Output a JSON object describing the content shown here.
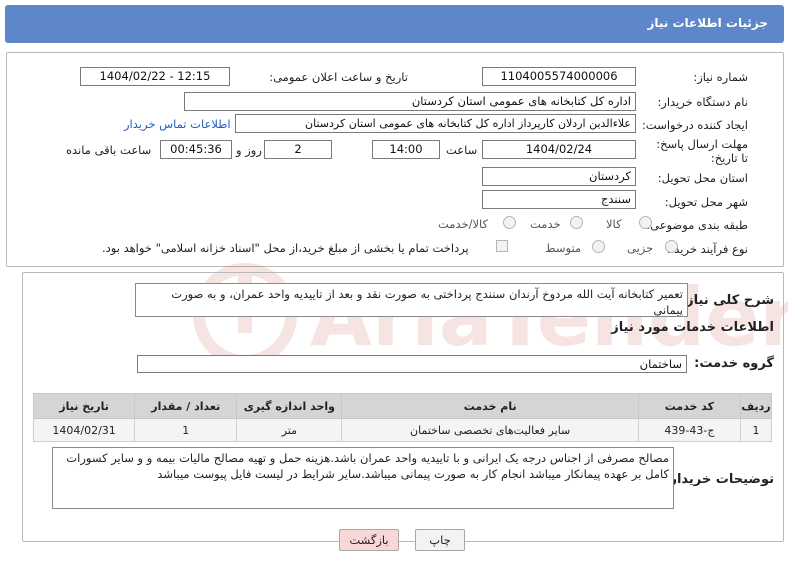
{
  "header": {
    "title": "جزئیات اطلاعات نیاز"
  },
  "form": {
    "need_number_label": "شماره نیاز:",
    "need_number": "1104005574000006",
    "announce_label": "تاریخ و ساعت اعلان عمومی:",
    "announce_value": "1404/02/22 - 12:15",
    "buyer_org_label": "نام دستگاه خریدار:",
    "buyer_org": "اداره کل کتابخانه های عمومی استان کردستان",
    "creator_label": "ایجاد کننده درخواست:",
    "creator": "علاءالدین اردلان کارپرداز اداره کل کتابخانه های عمومی استان کردستان",
    "contact_link": "اطلاعات تماس خریدار",
    "deadline_label": "مهلت ارسال پاسخ: تا تاریخ:",
    "deadline_date": "1404/02/24",
    "hour_label": "ساعت",
    "deadline_time": "14:00",
    "days_value": "2",
    "days_label": "روز و",
    "remaining_value": "00:45:36",
    "remaining_label": "ساعت باقی مانده",
    "province_label": "استان محل تحویل:",
    "province": "کردستان",
    "city_label": "شهر محل تحویل:",
    "city": "سنندج",
    "category_label": "طبقه بندی موضوعی:",
    "category_options": [
      "کالا",
      "خدمت",
      "کالا/خدمت"
    ],
    "process_label": "نوع فرآیند خرید :",
    "process_options": [
      "جزیی",
      "متوسط"
    ],
    "treasury_note": "پرداخت تمام یا بخشی از مبلغ خرید،از محل \"اسناد خزانه اسلامی\" خواهد بود."
  },
  "summary": {
    "label": "شرح کلی نیاز:",
    "text": "تعمیر کتابخانه آیت الله مردوخ آرندان سنندج پرداختی به صورت نقد و بعد از تاییدیه واحد عمران، و به صورت پیمانی"
  },
  "services": {
    "section_title": "اطلاعات خدمات مورد نیاز",
    "group_label": "گروه خدمت:",
    "group_value": "ساختمان",
    "columns": [
      "ردیف",
      "کد خدمت",
      "نام خدمت",
      "واحد اندازه گیری",
      "تعداد / مقدار",
      "تاریخ نیاز"
    ],
    "rows": [
      [
        "1",
        "ج-43-439",
        "سایر فعالیت‌های تخصصی ساختمان",
        "متر",
        "1",
        "1404/02/31"
      ]
    ]
  },
  "buyer_notes": {
    "label": "توضیحات خریدار:",
    "text": "مصالح مصرفی از اجناس درجه یک ایرانی و با تاییدیه واحد عمران باشد.هزینه حمل و تهیه مصالح مالیات بیمه و و سایر کسورات کامل بر عهده پیمانکار میباشد  انجام کار به صورت پیمانی میباشد.سایر شرایط در لیست فایل پیوست میباشد"
  },
  "buttons": {
    "print": "چاپ",
    "back": "بازگشت"
  },
  "colors": {
    "header": "#5d87c8",
    "back_button": "#f9d7d7",
    "link": "#1f5fbf"
  }
}
